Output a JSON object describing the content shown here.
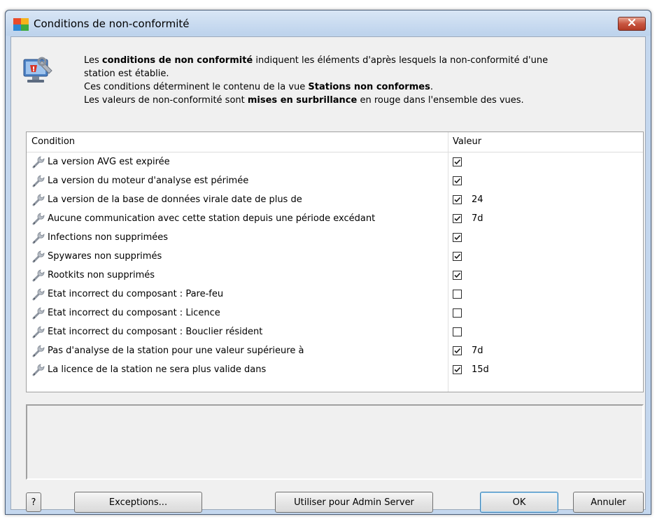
{
  "window": {
    "title": "Conditions de non-conformité"
  },
  "intro": {
    "line1_a": "Les ",
    "line1_b": "conditions de non conformité",
    "line1_c": " indiquent les éléments d'après lesquels la non-conformité d'une",
    "line2": "station est établie.",
    "line3_a": "Ces conditions déterminent le contenu de la vue ",
    "line3_b": "Stations non conformes",
    "line3_c": ".",
    "line4_a": "Les valeurs de non-conformité sont ",
    "line4_b": "mises en surbrillance",
    "line4_c": " en rouge dans l'ensemble des vues."
  },
  "table": {
    "headers": {
      "condition": "Condition",
      "valeur": "Valeur"
    },
    "rows": [
      {
        "label": "La version AVG est expirée",
        "checked": true,
        "value": ""
      },
      {
        "label": "La version du moteur d'analyse est périmée",
        "checked": true,
        "value": ""
      },
      {
        "label": "La version de la base de données virale date de plus de",
        "checked": true,
        "value": "24"
      },
      {
        "label": "Aucune communication avec cette station depuis une période excédant",
        "checked": true,
        "value": "7d"
      },
      {
        "label": "Infections non supprimées",
        "checked": true,
        "value": ""
      },
      {
        "label": "Spywares non supprimés",
        "checked": true,
        "value": ""
      },
      {
        "label": "Rootkits non supprimés",
        "checked": true,
        "value": ""
      },
      {
        "label": "Etat incorrect du composant : Pare-feu",
        "checked": false,
        "value": ""
      },
      {
        "label": "Etat incorrect du composant : Licence",
        "checked": false,
        "value": ""
      },
      {
        "label": "Etat incorrect du composant : Bouclier résident",
        "checked": false,
        "value": ""
      },
      {
        "label": "Pas d'analyse de la station pour une valeur supérieure à",
        "checked": true,
        "value": "7d"
      },
      {
        "label": "La licence de la station ne sera plus valide dans",
        "checked": true,
        "value": "15d"
      }
    ]
  },
  "buttons": {
    "help": "?",
    "exceptions": "Exceptions...",
    "admin_server": "Utiliser pour Admin Server",
    "ok": "OK",
    "cancel": "Annuler"
  },
  "icons": {
    "app": "avg-logo-icon",
    "header": "computer-warning-icon",
    "row": "wrench-icon",
    "close": "close-icon"
  },
  "colors": {
    "title_bar": "#bcd2ec",
    "close_button": "#c85540",
    "dialog_bg": "#f0f0f0"
  }
}
